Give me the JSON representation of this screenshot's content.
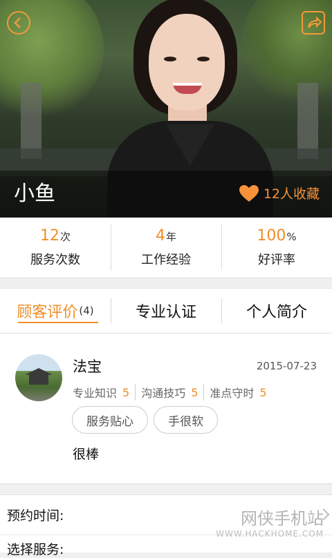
{
  "header": {
    "name": "小鱼",
    "favorites_label": "12人收藏"
  },
  "stats": [
    {
      "value": "12",
      "unit": "次",
      "label": "服务次数"
    },
    {
      "value": "4",
      "unit": "年",
      "label": "工作经验"
    },
    {
      "value": "100",
      "unit": "%",
      "label": "好评率"
    }
  ],
  "tabs": [
    {
      "label": "顾客评价",
      "count": "(4)",
      "active": true
    },
    {
      "label": "专业认证"
    },
    {
      "label": "个人简介"
    }
  ],
  "review": {
    "reviewer": "法宝",
    "date": "2015-07-23",
    "scores": [
      {
        "label": "专业知识",
        "value": "5"
      },
      {
        "label": "沟通技巧",
        "value": "5"
      },
      {
        "label": "准点守时",
        "value": "5"
      }
    ],
    "tags": [
      "服务贴心",
      "手很软"
    ],
    "comment": "很棒"
  },
  "booking": {
    "time_label": "预约时间:",
    "service_label": "选择服务:"
  },
  "watermark": {
    "title": "网侠手机站",
    "url": "WWW.HACKHOME.COM"
  },
  "colors": {
    "accent": "#f08d26"
  }
}
